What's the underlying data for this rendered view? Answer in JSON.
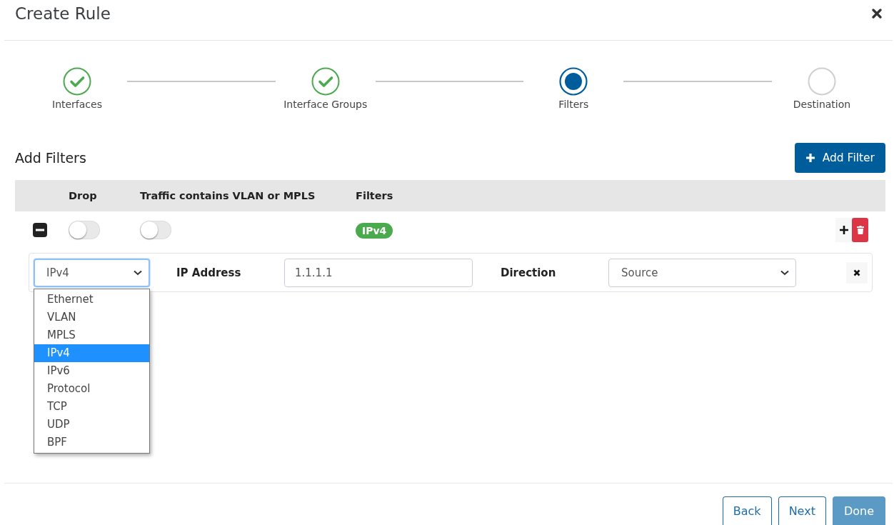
{
  "dialog": {
    "title": "Create Rule"
  },
  "steps": [
    {
      "label": "Interfaces",
      "kind": "done"
    },
    {
      "label": "Interface Groups",
      "kind": "done"
    },
    {
      "label": "Filters",
      "kind": "active"
    },
    {
      "label": "Destination",
      "kind": "pending"
    }
  ],
  "section": {
    "title": "Add Filters",
    "add_button": "Add Filter"
  },
  "table": {
    "columns": [
      "Drop",
      "Traffic contains VLAN or MPLS",
      "Filters"
    ],
    "rows": [
      {
        "expanded": true,
        "drop": false,
        "vlan_mpls": false,
        "badges": [
          "IPv4"
        ],
        "filters": [
          {
            "type_select": {
              "value": "IPv4",
              "open": true,
              "options": [
                {
                  "label": "Ethernet",
                  "selected": false
                },
                {
                  "label": "VLAN",
                  "selected": false
                },
                {
                  "label": "MPLS",
                  "selected": false
                },
                {
                  "label": "IPv4",
                  "selected": true
                },
                {
                  "label": "IPv6",
                  "selected": false
                },
                {
                  "label": "Protocol",
                  "selected": false
                },
                {
                  "label": "TCP",
                  "selected": false
                },
                {
                  "label": "UDP",
                  "selected": false
                },
                {
                  "label": "BPF",
                  "selected": false
                }
              ]
            },
            "address_label": "IP Address",
            "address_value": "1.1.1.1",
            "direction_label": "Direction",
            "direction_value": "Source"
          }
        ]
      }
    ]
  },
  "footer": {
    "buttons": [
      {
        "label": "Back",
        "kind": "outline",
        "disabled": false
      },
      {
        "label": "Next",
        "kind": "outline",
        "disabled": false
      },
      {
        "label": "Done",
        "kind": "primary",
        "disabled": true
      }
    ]
  }
}
